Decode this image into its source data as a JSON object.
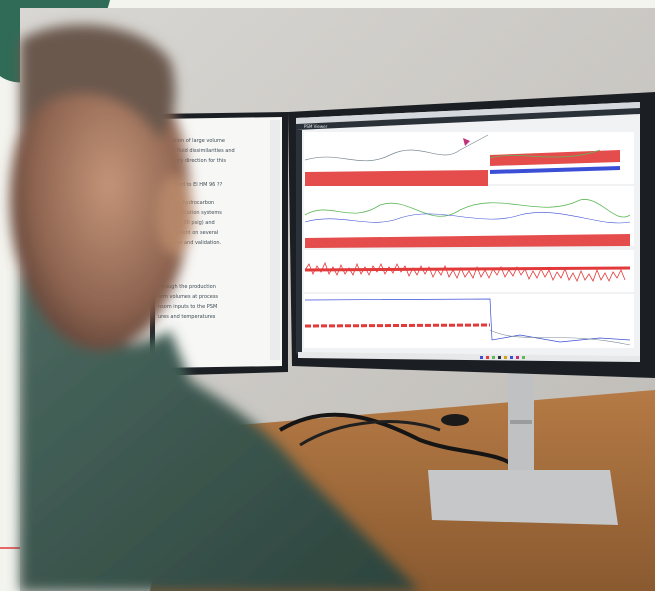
{
  "photo": {
    "subject": "person-viewing-dual-monitors",
    "palette": {
      "page_bg": "#f4f4ef",
      "wall": "#c9c7c4",
      "desk": "#a06a3a",
      "monitor_frame": "#1b1f24",
      "shirt": "#3f5a52",
      "skin": "#b98a6e",
      "accent_red": "#e23a3a",
      "accent_blue": "#3a4fd6",
      "accent_green": "#5fb85a",
      "teal_blob": "#2f6b57"
    }
  },
  "left_monitor": {
    "document_lines": [
      "realisation of large volume",
      "ity and fluid dissimilarities and",
      "d industry direction for this",
      "",
      "conformed to EI HM 96 ??",
      "",
      "ring from hydrocarbon",
      "ustom allocation systems",
      "ding to 1700 psig) and",
      "is dependent on several",
      "alification and validation.",
      "",
      "through the production",
      "orm volumes at process",
      "nsom inputs to the PSM",
      "ures and temperatures"
    ]
  },
  "right_monitor": {
    "app_title": "PSM Viewer",
    "panels": [
      {
        "name": "panel-1",
        "series": [
          "red",
          "blue",
          "green"
        ]
      },
      {
        "name": "panel-2",
        "series": [
          "red",
          "green",
          "blue"
        ]
      },
      {
        "name": "panel-3",
        "series": [
          "red"
        ]
      },
      {
        "name": "panel-4",
        "series": [
          "red",
          "blue"
        ]
      }
    ]
  }
}
